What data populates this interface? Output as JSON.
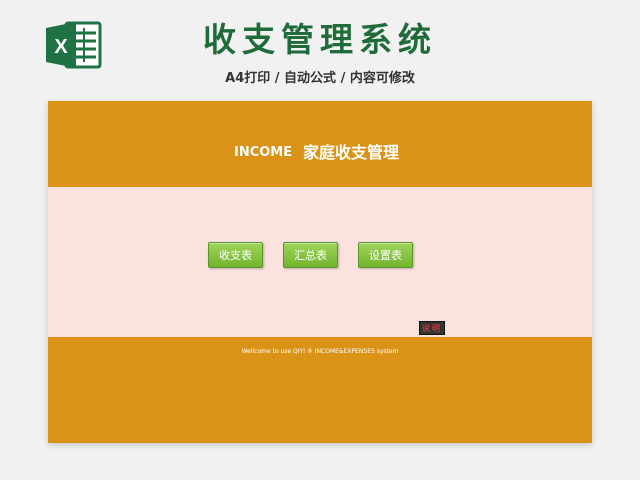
{
  "header": {
    "title": "收支管理系统",
    "subtitle": "A4打印 / 自动公式 / 内容可修改",
    "logo_icon": "excel-logo-icon",
    "logo_letter": "X",
    "brand_color": "#1f7244"
  },
  "banner": {
    "income_label": "INCOME",
    "title": "家庭收支管理",
    "background": "#db9317"
  },
  "menu": {
    "income_expense_button": "收支表",
    "summary_button": "汇总表",
    "settings_button": "设置表",
    "button_color": "#7fbf3a",
    "background": "#fce2df"
  },
  "help": {
    "label": "说明",
    "text_color": "#ff3b3b"
  },
  "footer": {
    "welcome_text": "Wellcome to use QIYI ® INCOME&EXPENSES system",
    "background": "#db9317"
  }
}
